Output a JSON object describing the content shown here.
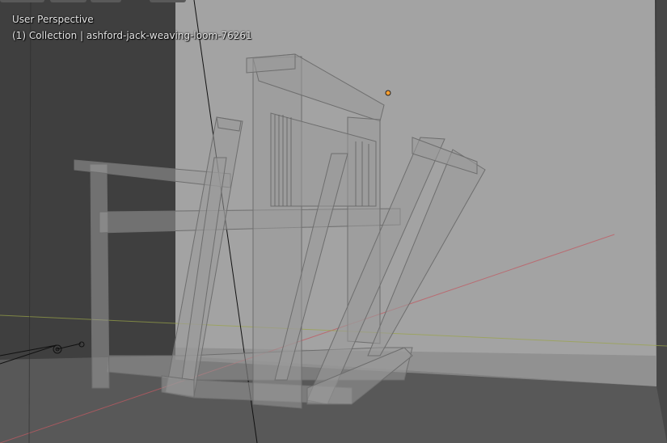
{
  "viewport": {
    "view_name": "User Perspective",
    "collection_prefix": "(1) Collection",
    "separator": "|",
    "active_object": "ashford-jack-weaving-loom-76261"
  },
  "header": {
    "tabs": [
      "",
      "",
      "",
      ""
    ]
  },
  "colors": {
    "viewport_bg": "#404040",
    "backdrop": "#a4a4a4",
    "floor": "#5a5a5a",
    "x_axis": "#c05058",
    "y_axis": "#96a040",
    "light_origin": "#ffa030"
  },
  "icons": [
    "light-object-icon",
    "camera-object-icon"
  ]
}
